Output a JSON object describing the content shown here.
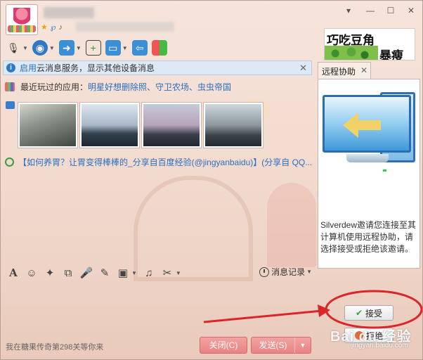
{
  "titlebar": {
    "contact_name": "",
    "signature": "",
    "controls": {
      "down": "▾",
      "minimize": "—",
      "maximize": "☐",
      "close": "✕"
    }
  },
  "ad": {
    "line1": "巧吃豆角",
    "line2": "暴瘦"
  },
  "notice": {
    "link": "启用",
    "text": "云消息服务，显示其他设备消息",
    "close": "✕"
  },
  "chat": {
    "apps_label": "最近玩过的应用：",
    "apps_list": "明星好想删除照、守卫农场、虫虫帝国",
    "share_text": "【如何养胃？让胃变得棒棒的_分享自百度经验(@jingyanbaidu)】(分享自 QQ..."
  },
  "input_tools": {
    "icons": [
      "font-icon",
      "emoji-icon",
      "shake-icon",
      "screenshot-icon",
      "voice-icon",
      "edit-icon",
      "image-icon",
      "music-icon",
      "scissors-icon"
    ],
    "history_label": "消息记录"
  },
  "bottom": {
    "game_status": "我在糖果传奇第298关等你来",
    "close_label": "关闭(C)",
    "send_label": "发送(S)",
    "send_arrow": "▼"
  },
  "remote": {
    "tab_label": "远程协助",
    "tab_close": "✕",
    "message": "Silverdew邀请您连接至其计算机使用远程协助，请选择接受或拒绝该邀请。",
    "accept_label": "接受",
    "reject_label": "拒绝"
  },
  "watermark": {
    "brand": "Bai du 经验",
    "url": "jingyan.baidu.com"
  },
  "colors": {
    "link": "#2a6fc0",
    "button_red": "#e98383",
    "annotation": "#d9262a"
  }
}
